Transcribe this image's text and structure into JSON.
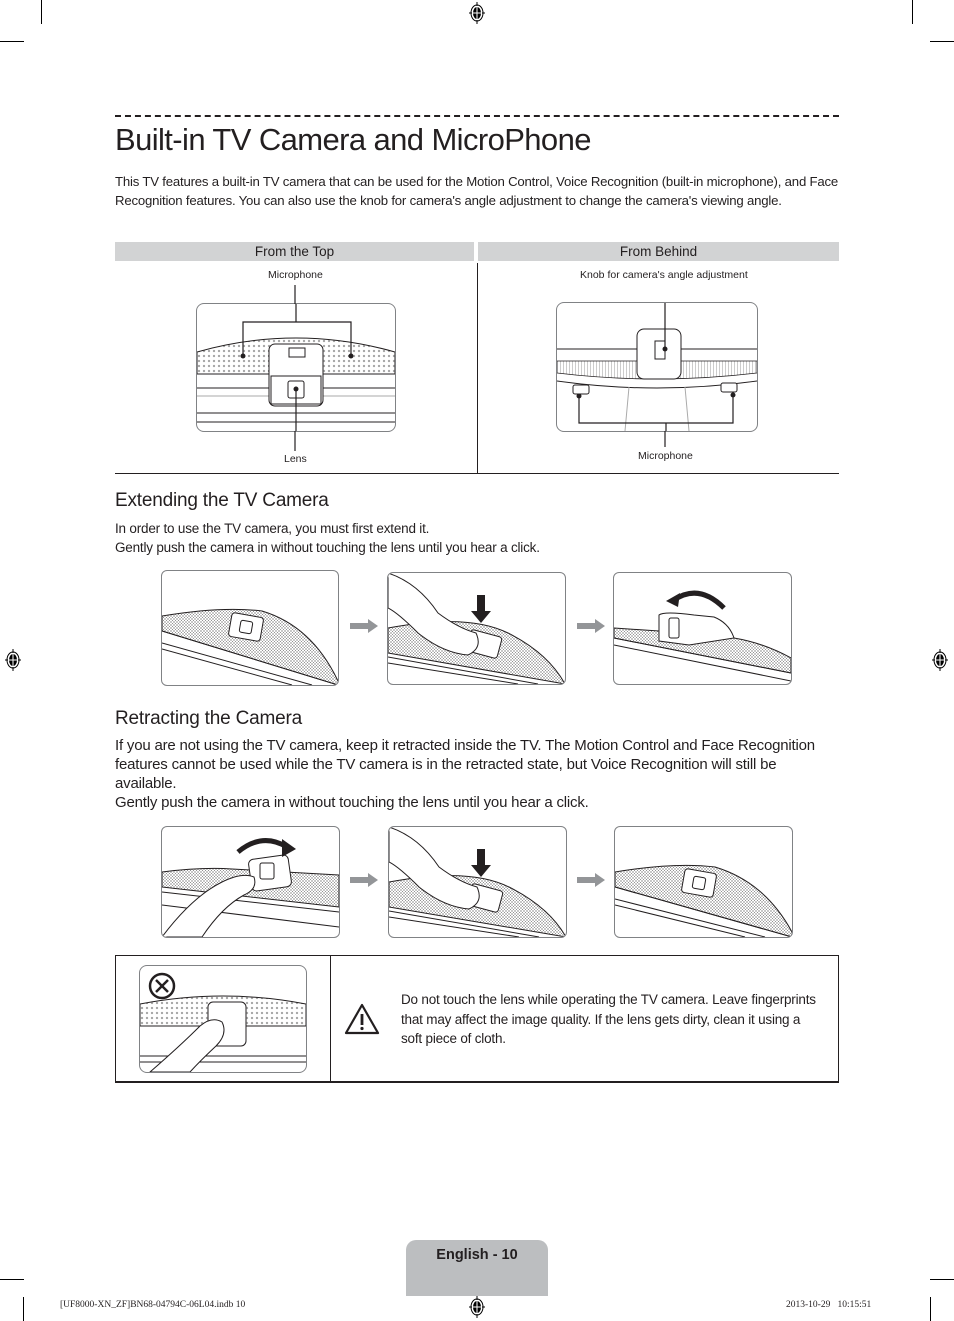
{
  "page": {
    "title": "Built-in TV Camera and MicroPhone",
    "intro": "This TV features a built-in TV camera that can be used for the Motion Control, Voice Recognition (built-in microphone), and Face Recognition features. You can also use the knob for camera's angle adjustment to change the camera's viewing angle."
  },
  "views": {
    "top": {
      "header": "From the Top",
      "labels": {
        "microphone": "Microphone",
        "lens": "Lens"
      }
    },
    "behind": {
      "header": "From Behind",
      "labels": {
        "knob": "Knob for camera's angle adjustment",
        "microphone": "Microphone"
      }
    }
  },
  "extending": {
    "heading": "Extending the TV Camera",
    "line1": "In order to use the TV camera, you must first extend it.",
    "line2": "Gently push the camera in without touching the lens until you hear a click.",
    "steps": [
      "camera-retracted",
      "finger-push-down",
      "camera-extended-rotate"
    ]
  },
  "retracting": {
    "heading": "Retracting the Camera",
    "para1": "If you are not using the TV camera, keep it retracted inside the TV. The Motion Control and Face Recognition features cannot be used while the TV camera is in the retracted state, but Voice Recognition will still be available.",
    "para2": "Gently push the camera in without touching the lens until you hear a click.",
    "steps": [
      "camera-rotate-back",
      "finger-push-down",
      "camera-retracted"
    ]
  },
  "caution": {
    "text": "Do not touch the lens while operating the TV camera. Leave fingerprints that may affect the image quality. If the lens gets dirty, clean it using a soft piece of cloth.",
    "prohibited_icon": "prohibited-icon",
    "warning_icon": "warning-triangle-icon"
  },
  "footer": {
    "page_label": "English - 10",
    "file_slug": "[UF8000-XN_ZF]BN68-04794C-06L04.indb   10",
    "timestamp": "2013-10-29     10:15:51"
  },
  "colors": {
    "text": "#231f20",
    "header_bg": "#d2d3d4",
    "page_tab_bg": "#bcbec0",
    "illus_border": "#808285",
    "flow_arrow": "#939598"
  }
}
